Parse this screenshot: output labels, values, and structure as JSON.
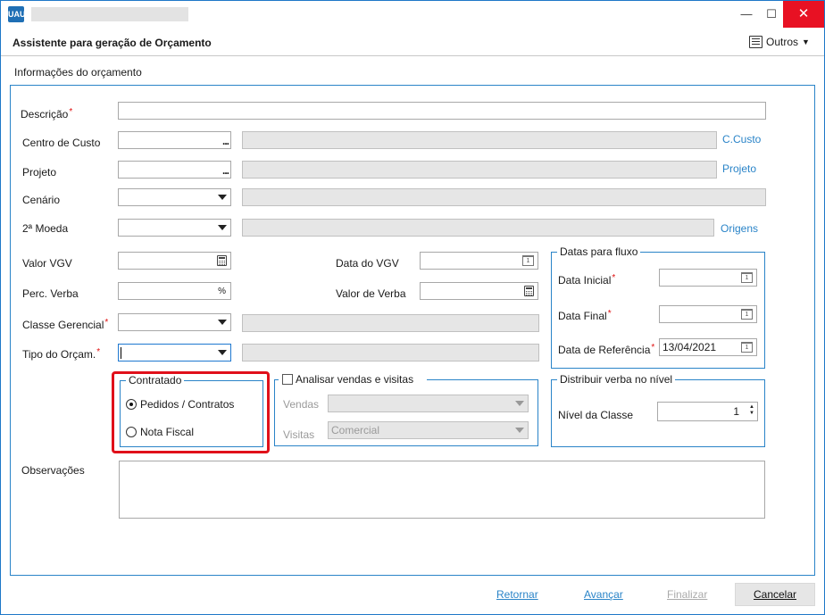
{
  "window": {
    "app_icon_text": "UAU",
    "min_icon": "minimize-icon",
    "max_icon": "maximize-icon",
    "close_icon": "close-icon"
  },
  "header": {
    "title": "Assistente para geração de Orçamento",
    "outros_label": "Outros"
  },
  "section_title": "Informações do orçamento",
  "form": {
    "descricao_label": "Descrição",
    "centro_custo_label": "Centro de Custo",
    "centro_custo_link": "C.Custo",
    "projeto_label": "Projeto",
    "projeto_link": "Projeto",
    "cenario_label": "Cenário",
    "moeda_label": "2ª Moeda",
    "moeda_link": "Origens",
    "valor_vgv_label": "Valor VGV",
    "data_vgv_label": "Data do VGV",
    "perc_verba_label": "Perc. Verba",
    "perc_symbol": "%",
    "valor_verba_label": "Valor de Verba",
    "classe_gerencial_label": "Classe Gerencial",
    "tipo_orcam_label": "Tipo do Orçam.",
    "observacoes_label": "Observações",
    "required_mark": "*",
    "dots": "..."
  },
  "datas_fluxo": {
    "title": "Datas para fluxo",
    "data_inicial_label": "Data Inicial",
    "data_final_label": "Data Final",
    "data_referencia_label": "Data de Referência",
    "data_referencia_value": "13/04/2021",
    "calendar_day": "1"
  },
  "contratado": {
    "title": "Contratado",
    "options": [
      "Pedidos / Contratos",
      "Nota Fiscal"
    ],
    "selected": "Pedidos / Contratos"
  },
  "analisar": {
    "checkbox_label": "Analisar vendas e visitas",
    "checked": false,
    "vendas_label": "Vendas",
    "visitas_label": "Visitas",
    "visitas_value": "Comercial"
  },
  "distribuir": {
    "title": "Distribuir verba no nível",
    "nivel_label": "Nível da Classe",
    "nivel_value": "1"
  },
  "footer": {
    "retornar": "Retornar",
    "avancar": "Avançar",
    "finalizar": "Finalizar",
    "cancelar": "Cancelar"
  }
}
